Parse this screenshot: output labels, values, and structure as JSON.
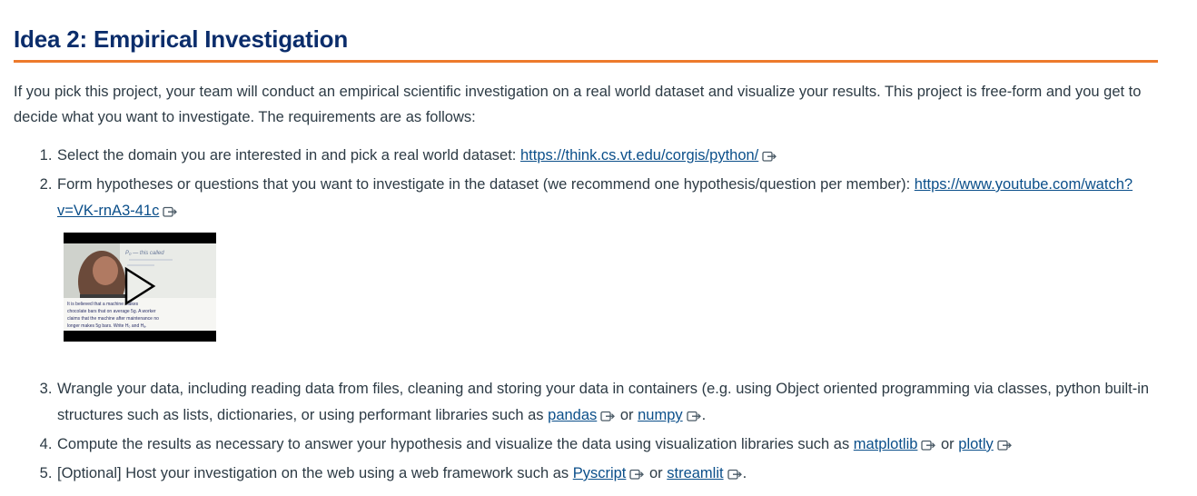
{
  "heading": "Idea 2: Empirical Investigation",
  "intro": "If you pick this project, your team will conduct an empirical scientific investigation on a real world dataset and visualize your results. This project is free-form and you get to decide what you want to investigate. The requirements are as follows:",
  "items": [
    {
      "text": "Select the domain you are interested in and pick a real world dataset: ",
      "link": "https://think.cs.vt.edu/corgis/python/"
    },
    {
      "text": "Form hypotheses or questions that you want to investigate in the dataset (we recommend one hypothesis/question per member): ",
      "link": "https://www.youtube.com/watch?v=VK-rnA3-41c"
    },
    {
      "text": "Wrangle your data, including reading data from files, cleaning and storing your data in containers (e.g. using Object oriented programming via classes, python built-in structures such as lists, dictionaries, or using performant libraries such as ",
      "link1": "pandas",
      "mid": " or ",
      "link2": "numpy",
      "end": "."
    },
    {
      "text": "Compute the results as necessary to answer your hypothesis and visualize the data using visualization libraries such as ",
      "link1": "matplotlib",
      "mid": " or ",
      "link2": "plotly",
      "end": ""
    },
    {
      "text": "[Optional] Host your investigation on the web using a web framework such as ",
      "link1": "Pyscript",
      "mid": " or ",
      "link2": "streamlit",
      "end": "."
    }
  ],
  "video": {
    "whiteboard_line1": "P₀ — this called",
    "whiteboard_line2": "It is believed that a machine makes",
    "whiteboard_line3": "chocolate bars that on average 5g. A worker",
    "whiteboard_line4": "claims that the machine after maintenance no",
    "whiteboard_line5": "longer makes 5g bars. Write H₀ and Hₐ."
  },
  "colors": {
    "heading": "#0b2d6b",
    "rule": "#ed7a2c",
    "link": "#0b4f8a",
    "text": "#2d3b45"
  },
  "icons": [
    "external-link-icon",
    "play-icon"
  ]
}
